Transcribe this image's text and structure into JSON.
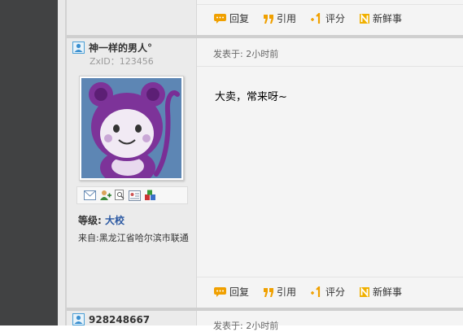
{
  "actions": {
    "reply": "回复",
    "quote": "引用",
    "rate": "评分",
    "fresh": "新鲜事"
  },
  "post": {
    "author_name": "神一样的男人°",
    "zxid_label": "ZxID：",
    "zxid_value": "123456",
    "time": "发表于: 2小时前",
    "content": "大卖，常来呀~",
    "level_label": "等级:",
    "level_value": "大校",
    "from_label": "来自:",
    "from_value": "黑龙江省哈尔滨市联通"
  },
  "next_post": {
    "author_name": "928248667",
    "time": "发表于: 2小时前"
  },
  "colors": {
    "accent_blue": "#2a58a2",
    "icon_orange": "#f0a000"
  }
}
